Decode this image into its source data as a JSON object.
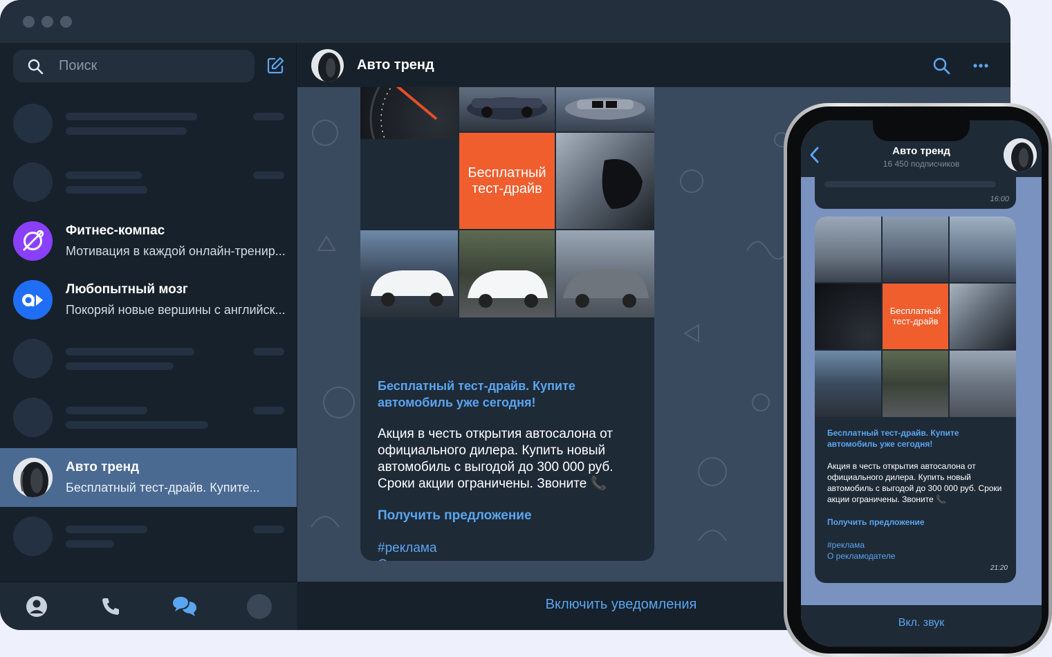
{
  "colors": {
    "accent": "#5aa5ef",
    "promo": "#f05e2e",
    "active_chat": "#4a6a92"
  },
  "search": {
    "placeholder": "Поиск"
  },
  "chats": [
    {
      "name": "Фитнес-компас",
      "message": "Мотивация в каждой онлайн-тренир..."
    },
    {
      "name": "Любопытный мозг",
      "message": "Покоряй новые вершины с английск..."
    },
    {
      "name": "Авто тренд",
      "message": "Бесплатный тест-драйв. Купите..."
    }
  ],
  "channel": {
    "title": "Авто тренд",
    "subscribers": "16 450 подписчиков"
  },
  "post": {
    "promo_tile": "Бесплатный тест-драйв",
    "title": "Бесплатный тест-драйв. Купите автомобиль уже сегодня!",
    "body": "Акция в честь открытия автосалона от официального дилера. Купить новый автомобиль с выгодой до 300 000 руб. Сроки акции ограничены. Звоните 📞",
    "cta": "Получить предложение",
    "hashtag": "#реклама",
    "about": "О рекламодателе",
    "time": "21:20"
  },
  "footer": {
    "notify": "Включить уведомления"
  },
  "phone": {
    "prev_time": "16:00",
    "sound": "Вкл. звук"
  }
}
